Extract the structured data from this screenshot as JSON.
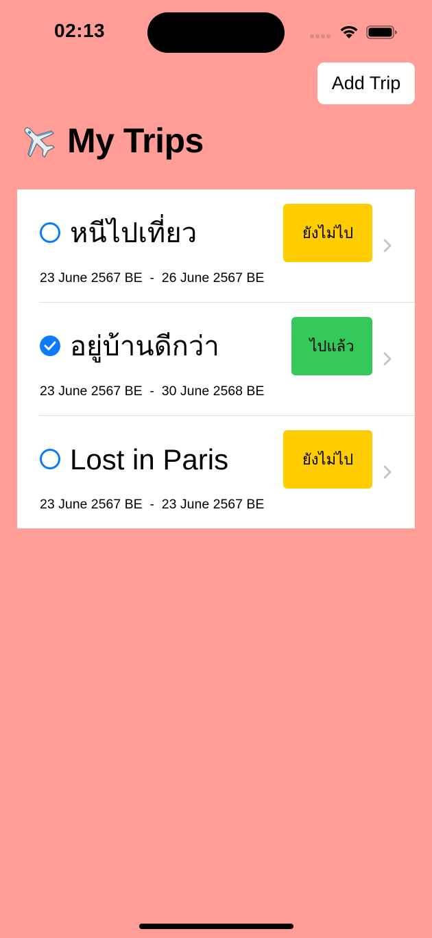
{
  "status_bar": {
    "time": "02:13",
    "icons": [
      "signal-dots-icon",
      "wifi-icon",
      "battery-icon"
    ]
  },
  "header": {
    "add_button_label": "Add Trip"
  },
  "title": {
    "icon": "airplane-icon",
    "text": "My Trips"
  },
  "trips": [
    {
      "name": "หนีไปเที่ยว",
      "checked": false,
      "status": "ยังไม่ไป",
      "dates": "23 June 2567 BE  -  26 June 2567 BE"
    },
    {
      "name": "อยู่บ้านดีกว่า",
      "checked": true,
      "status": "ไปแล้ว",
      "dates": "23 June 2567 BE  -  30 June 2568 BE"
    },
    {
      "name": "Lost in Paris",
      "checked": false,
      "status": "ยังไม่ไป",
      "dates": "23 June 2567 BE  -  23 June 2567 BE"
    }
  ],
  "colors": {
    "background": "#ff9d96",
    "accent": "#0a7aff",
    "pending_badge": "#ffcc00",
    "done_badge": "#34c759"
  }
}
